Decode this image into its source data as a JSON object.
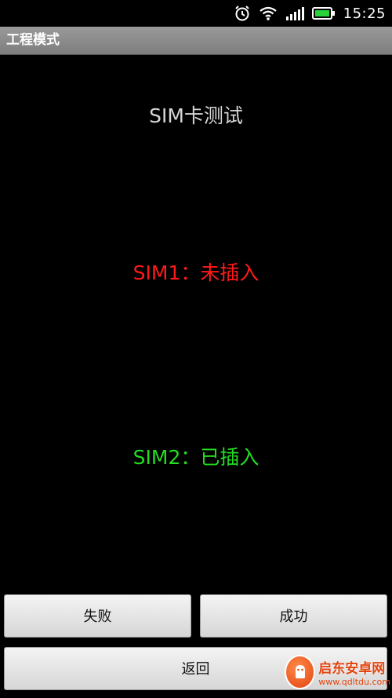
{
  "status_bar": {
    "time": "15:25",
    "icons": [
      "alarm-icon",
      "wifi-icon",
      "signal-icon",
      "battery-icon"
    ]
  },
  "title_bar": {
    "title": "工程模式"
  },
  "main": {
    "heading": "SIM卡测试",
    "sim1": {
      "text": "SIM1：未插入",
      "color": "#ff1a1a"
    },
    "sim2": {
      "text": "SIM2：已插入",
      "color": "#22dd22"
    }
  },
  "buttons": {
    "fail": "失败",
    "success": "成功",
    "back": "返回"
  },
  "watermark": {
    "brand": "启东安卓网",
    "url": "www.qdltdu.com"
  }
}
